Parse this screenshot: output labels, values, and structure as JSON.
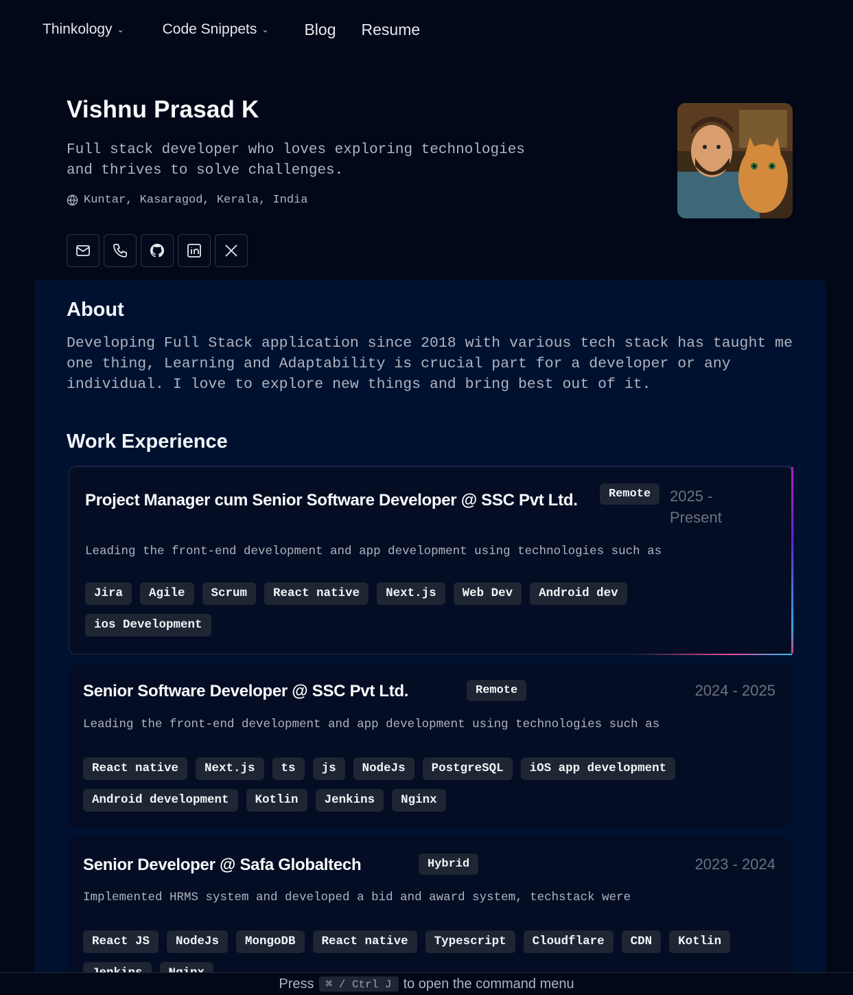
{
  "nav": {
    "items": [
      {
        "label": "Thinkology",
        "dropdown": true
      },
      {
        "label": "Code Snippets",
        "dropdown": true
      },
      {
        "label": "Blog",
        "dropdown": false
      },
      {
        "label": "Resume",
        "dropdown": false
      }
    ]
  },
  "profile": {
    "name": "Vishnu Prasad K",
    "tagline": "Full stack developer who loves exploring technologies and thrives to solve challenges.",
    "location": "Kuntar, Kasaragod, Kerala, India",
    "socials": [
      "mail-icon",
      "phone-icon",
      "github-icon",
      "linkedin-icon",
      "x-icon"
    ]
  },
  "about": {
    "title": "About",
    "text": "Developing Full Stack application since 2018 with various tech stack has taught me one thing, Learning and Adaptability is crucial part for a developer or any individual. I love to explore new things and bring best out of it."
  },
  "work": {
    "title": "Work Experience",
    "jobs": [
      {
        "title": "Project Manager cum Senior Software Developer @ SSC Pvt Ltd.",
        "badge": "Remote",
        "period": "2025 - Present",
        "description": "Leading the front-end development and app development using technologies such as",
        "tags": [
          "Jira",
          "Agile",
          "Scrum",
          "React native",
          "Next.js",
          "Web Dev",
          "Android dev",
          "ios Development"
        ]
      },
      {
        "title": "Senior Software Developer @ SSC Pvt Ltd.",
        "badge": "Remote",
        "period": "2024 - 2025",
        "description": "Leading the front-end development and app development using technologies such as",
        "tags": [
          "React native",
          "Next.js",
          "ts",
          "js",
          "NodeJs",
          "PostgreSQL",
          "iOS app development",
          "Android development",
          "Kotlin",
          "Jenkins",
          "Nginx"
        ]
      },
      {
        "title": "Senior Developer @ Safa Globaltech",
        "badge": "Hybrid",
        "period": "2023 - 2024",
        "description": "Implemented HRMS system and developed a bid and award system, techstack were",
        "tags": [
          "React JS",
          "NodeJs",
          "MongoDB",
          "React native",
          "Typescript",
          "Cloudflare",
          "CDN",
          "Kotlin",
          "Jenkins",
          "Nginx"
        ]
      }
    ]
  },
  "command_bar": {
    "prefix": "Press",
    "shortcut": "⌘ / Ctrl J",
    "suffix": "to open the command menu"
  }
}
